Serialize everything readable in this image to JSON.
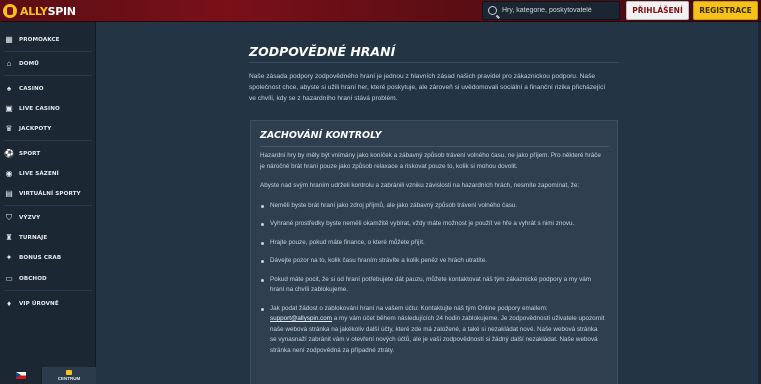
{
  "header": {
    "logo_part1": "ALLY",
    "logo_part2": "SPIN",
    "search_placeholder": "Hry, kategorie, poskytovatelé",
    "login_label": "PŘIHLÁŠENÍ",
    "register_label": "REGISTRACE"
  },
  "sidebar": {
    "items": [
      {
        "label": "PROMOAKCE",
        "icon": "promo-icon"
      },
      {
        "label": "DOMŮ",
        "icon": "home-icon"
      },
      {
        "label": "CASINO",
        "icon": "casino-icon"
      },
      {
        "label": "LIVE CASINO",
        "icon": "live-casino-icon"
      },
      {
        "label": "JACKPOTY",
        "icon": "jackpot-icon"
      },
      {
        "label": "SPORT",
        "icon": "sport-icon"
      },
      {
        "label": "LIVE SÁZENÍ",
        "icon": "live-betting-icon"
      },
      {
        "label": "VIRTUÁLNÍ SPORTY",
        "icon": "virtual-sports-icon"
      },
      {
        "label": "VÝZVY",
        "icon": "challenges-icon"
      },
      {
        "label": "TURNAJE",
        "icon": "tournaments-icon"
      },
      {
        "label": "BONUS CRAB",
        "icon": "bonus-crab-icon"
      },
      {
        "label": "OBCHOD",
        "icon": "shop-icon"
      },
      {
        "label": "VIP ÚROVNĚ",
        "icon": "vip-icon"
      }
    ],
    "support_label": "CENTRUM"
  },
  "main": {
    "title": "ZODPOVĚDNÉ HRANÍ",
    "intro": "Naše zásada podpory zodpovědného hraní je jednou z hlavních zásad našich pravidel pro zákaznickou podporu. Naše společnost chce, abyste si užili hraní her, které poskytuje, ale zároveň si uvědomovali sociální a finanční rizika přicházející ve chvíli, kdy se z hazardního hraní stává problém.",
    "card": {
      "title": "ZACHOVÁNÍ KONTROLY",
      "p1": "Hazardní hry by měly být vnímány jako koníček a zábavný způsob trávení volného času, ne jako příjem. Pro některé hráče je náročné brát hraní pouze jako způsob relaxace a riskovat pouze to, kolik si mohou dovolit.",
      "p2": "Abyste nad svým hraním udrželi kontrolu a zabránili vzniku závislosti na hazardních hrách, nesmíte zapomínat, že:",
      "bullets": [
        "Neměli byste brát hraní jako zdroj příjmů, ale jako zábavný způsob trávení volného času.",
        "Vyhrané prostředky byste neměli okamžitě vybírat, vždy máte možnost je použít ve hře a vyhrát s nimi znovu.",
        "Hrajte pouze, pokud máte finance, o které můžete přijít.",
        "Dávejte pozor na to, kolik času hraním strávíte a kolik peněz ve hrách utratíte.",
        "Pokud máte pocit, že si od hraní potřebujete dát pauzu, můžete kontaktovat náš tým zákaznické podpory a my vám hraní na chvíli zablokujeme."
      ],
      "last_prefix": "Jak podat žádost o zablokování hraní na vašem účtu: Kontaktujte náš tým Online podpory emailem: ",
      "last_email": "support@allyspin.com",
      "last_suffix": " a my vám účet během následujících 24 hodin zablokujeme. Je zodpovědností uživatele upozornit naše webová stránka na jakékoliv další účty, které zde má založené, a také si nezakládat nové. Naše webová stránka se vynasnaží zabránit vám v otevření nových účtů, ale je vaší zodpovědností si žádný další nezakládat. Naše webová stránka není zodpovědná za případné ztráty."
    }
  }
}
